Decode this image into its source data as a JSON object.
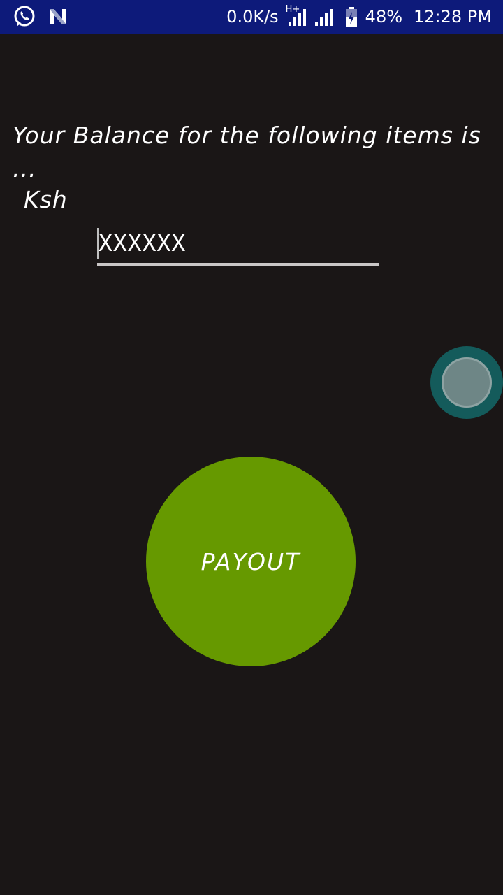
{
  "status_bar": {
    "left_icons": [
      "whatsapp-icon",
      "n-notification-icon"
    ],
    "network_speed": "0.0K/s",
    "network_type": "H+",
    "battery_percent": "48%",
    "time": "12:28 PM"
  },
  "content": {
    "heading": "Your Balance for the following items is ...",
    "currency": "Ksh",
    "amount_value": "XXXXXX"
  },
  "payout_button": {
    "label": "PAYOUT",
    "color": "#669900"
  },
  "colors": {
    "background": "#1a1616",
    "status_bar": "#0d1a7a",
    "bubble_outer": "#145b5b",
    "bubble_inner": "#6e8686"
  }
}
